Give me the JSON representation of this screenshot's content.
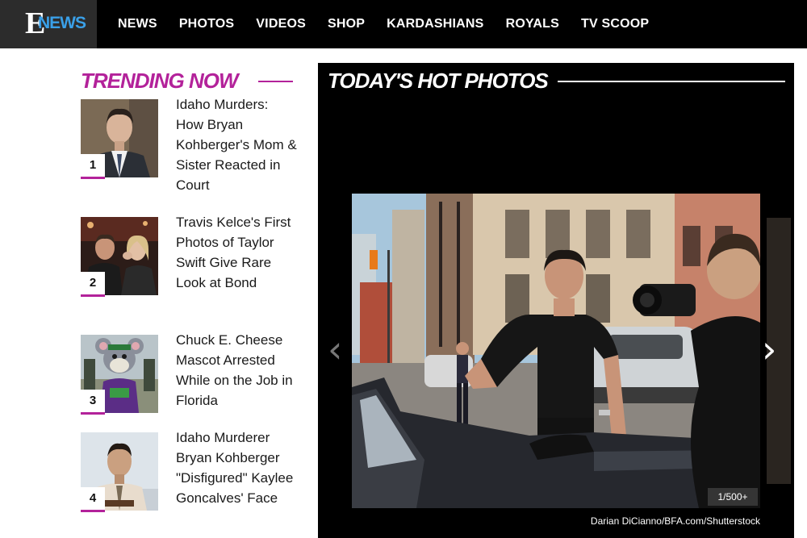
{
  "brand": {
    "logo_letter": "E",
    "logo_word": "NEWS",
    "accent_color": "#b3229a",
    "logo_blue": "#3aa0e8"
  },
  "nav": {
    "items": [
      {
        "label": "NEWS"
      },
      {
        "label": "PHOTOS"
      },
      {
        "label": "VIDEOS"
      },
      {
        "label": "SHOP"
      },
      {
        "label": "KARDASHIANS"
      },
      {
        "label": "ROYALS"
      },
      {
        "label": "TV SCOOP"
      }
    ]
  },
  "trending": {
    "title": "TRENDING NOW",
    "stories": [
      {
        "rank": "1",
        "headline": "Idaho Murders: How Bryan Kohberger's Mom & Sister Reacted in Court"
      },
      {
        "rank": "2",
        "headline": "Travis Kelce's First Photos of Taylor Swift Give Rare Look at Bond"
      },
      {
        "rank": "3",
        "headline": "Chuck E. Cheese Mascot Arrested While on the Job in Florida"
      },
      {
        "rank": "4",
        "headline": "Idaho Murderer Bryan Kohberger \"Disfigured\" Kaylee Goncalves' Face"
      }
    ]
  },
  "hot_photos": {
    "title": "TODAY'S HOT PHOTOS",
    "counter": "1/500+",
    "credit": "Darian DiCianno/BFA.com/Shutterstock",
    "prev_icon": "chevron-left-icon",
    "next_icon": "chevron-right-icon"
  }
}
